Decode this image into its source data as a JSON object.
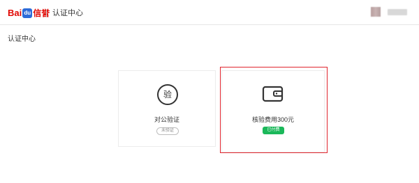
{
  "header": {
    "logo_text_a": "Bai",
    "logo_paw_text": "du",
    "logo_text_b": "信誉",
    "app_title": "认证中心"
  },
  "page": {
    "title": "认证中心"
  },
  "cards": [
    {
      "icon_char": "验",
      "label": "对公验证",
      "status": "未验证"
    },
    {
      "label": "核验费用300元",
      "status": "已付费"
    }
  ],
  "colors": {
    "brand_red": "#e10601",
    "highlight_red": "#e0242d",
    "paid_green": "#1bb85a"
  },
  "icons": {
    "card_corporate": "verify-character-icon",
    "card_fee": "wallet-icon"
  }
}
